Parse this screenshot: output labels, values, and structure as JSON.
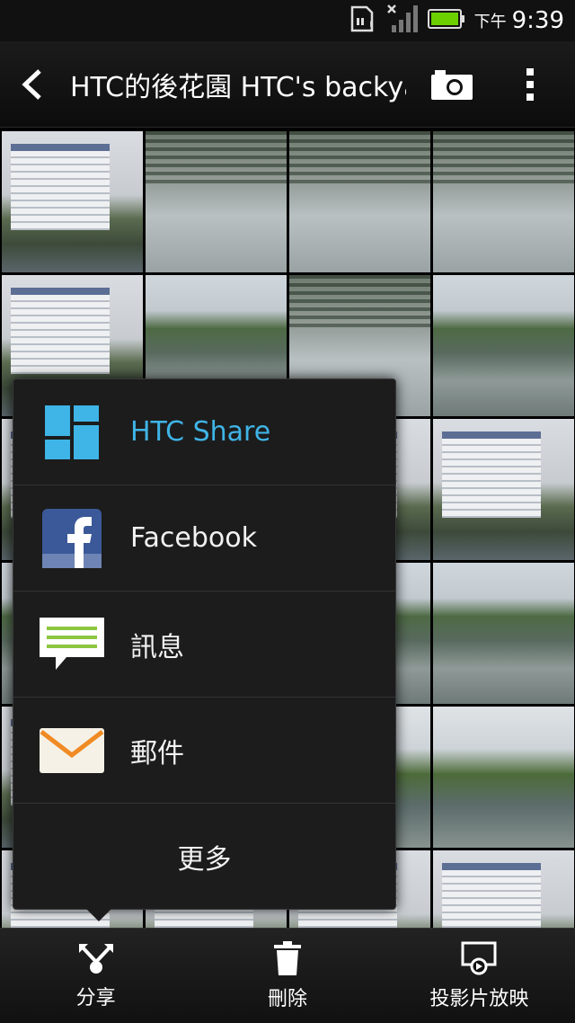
{
  "status_bar": {
    "ampm": "下午",
    "time": "9:39"
  },
  "action_bar": {
    "title": "HTC的後花園 HTC's backyard"
  },
  "grid": {
    "tiles": [
      "building",
      "water",
      "water",
      "water",
      "building",
      "pond",
      "water",
      "pond",
      "building",
      "building",
      "building",
      "building",
      "pond",
      "pond",
      "pond",
      "pond",
      "building",
      "fountain",
      "fountain",
      "fountain",
      "building",
      "building",
      "building",
      "building"
    ]
  },
  "share_menu": {
    "items": [
      {
        "label": "HTC Share",
        "icon": "htc-share-icon",
        "accent": true
      },
      {
        "label": "Facebook",
        "icon": "facebook-icon",
        "accent": false
      },
      {
        "label": "訊息",
        "icon": "message-icon",
        "accent": false
      },
      {
        "label": "郵件",
        "icon": "mail-icon",
        "accent": false
      }
    ],
    "more_label": "更多"
  },
  "bottom_bar": {
    "share_label": "分享",
    "delete_label": "刪除",
    "slideshow_label": "投影片放映"
  },
  "colors": {
    "accent": "#3fb4e6",
    "facebook": "#3b5998",
    "message_green": "#8cc63f",
    "battery_green": "#6cd000"
  }
}
